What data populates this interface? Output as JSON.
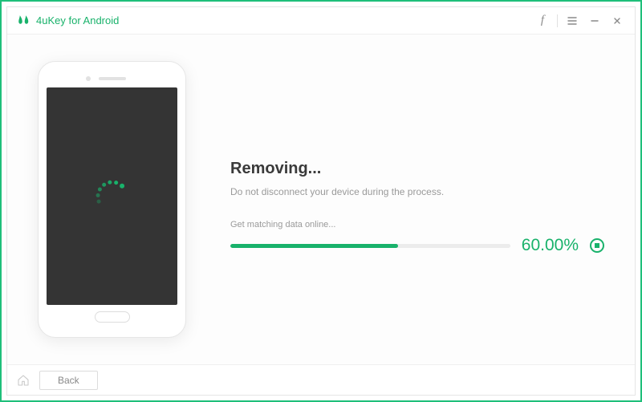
{
  "app": {
    "title": "4uKey for Android"
  },
  "colors": {
    "accent": "#19b26b"
  },
  "progress": {
    "heading": "Removing...",
    "warning": "Do not disconnect your device during the process.",
    "status": "Get matching data online...",
    "percent_label": "60.00%",
    "percent_value": 60
  },
  "footer": {
    "back_label": "Back"
  }
}
